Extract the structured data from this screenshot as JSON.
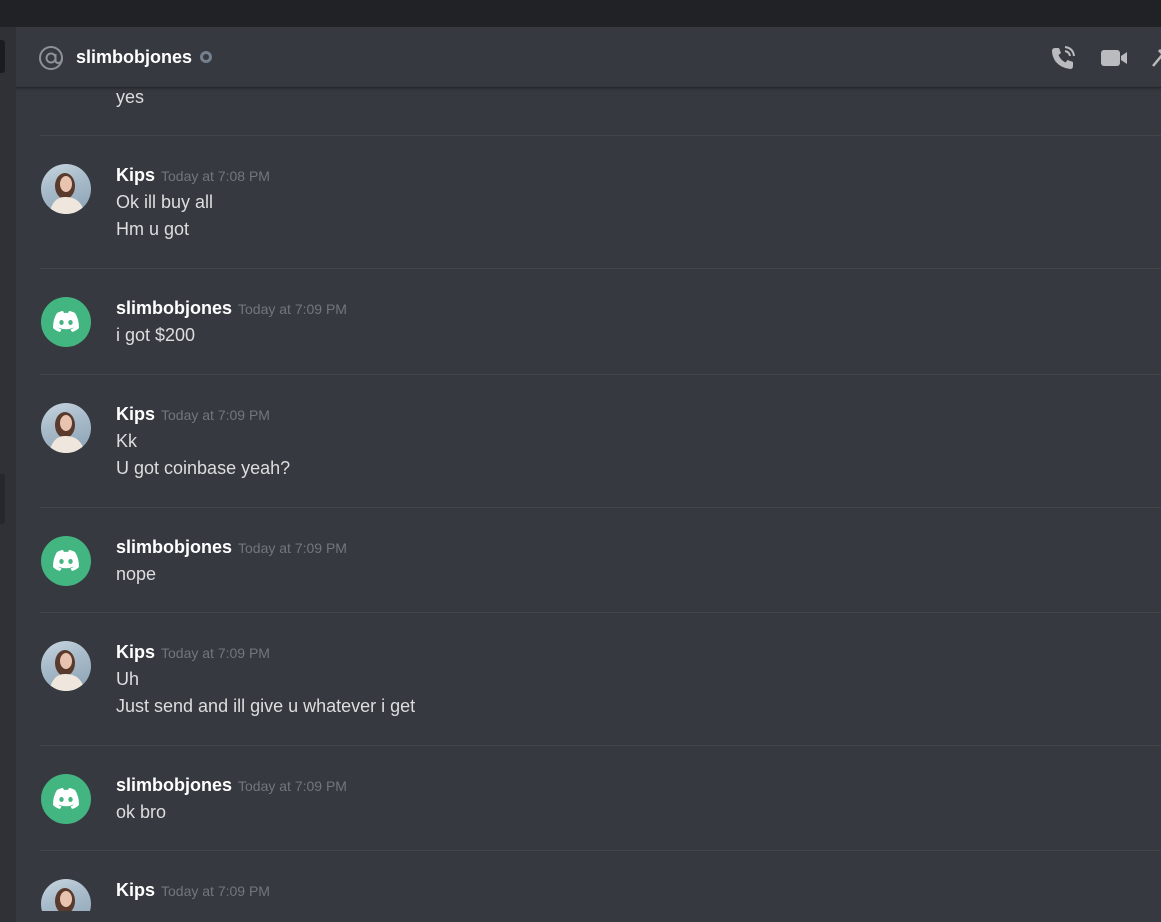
{
  "header": {
    "channel_icon": "at-sign-icon",
    "title": "slimbobjones",
    "status": "offline",
    "actions": [
      "phone-call-icon",
      "video-camera-icon",
      "pin-icon"
    ]
  },
  "colors": {
    "background": "#36393f",
    "username": "#ffffff",
    "text": "#dcddde",
    "timestamp": "#72767d",
    "discord_avatar": "#43b581"
  },
  "messages": {
    "partial_top": "yes",
    "groups": [
      {
        "author": "Kips",
        "avatar": "photo-avatar",
        "timestamp": "Today at 7:08 PM",
        "lines": [
          "Ok ill buy all",
          "Hm u got"
        ]
      },
      {
        "author": "slimbobjones",
        "avatar": "discord-logo-avatar",
        "timestamp": "Today at 7:09 PM",
        "lines": [
          "i got $200"
        ]
      },
      {
        "author": "Kips",
        "avatar": "photo-avatar",
        "timestamp": "Today at 7:09 PM",
        "lines": [
          "Kk",
          "U got coinbase yeah?"
        ]
      },
      {
        "author": "slimbobjones",
        "avatar": "discord-logo-avatar",
        "timestamp": "Today at 7:09 PM",
        "lines": [
          "nope"
        ]
      },
      {
        "author": "Kips",
        "avatar": "photo-avatar",
        "timestamp": "Today at 7:09 PM",
        "lines": [
          "Uh",
          "Just send and ill give u whatever i get"
        ]
      },
      {
        "author": "slimbobjones",
        "avatar": "discord-logo-avatar",
        "timestamp": "Today at 7:09 PM",
        "lines": [
          "ok bro"
        ]
      },
      {
        "author": "Kips",
        "avatar": "photo-avatar",
        "timestamp": "Today at 7:09 PM",
        "lines": []
      }
    ]
  }
}
